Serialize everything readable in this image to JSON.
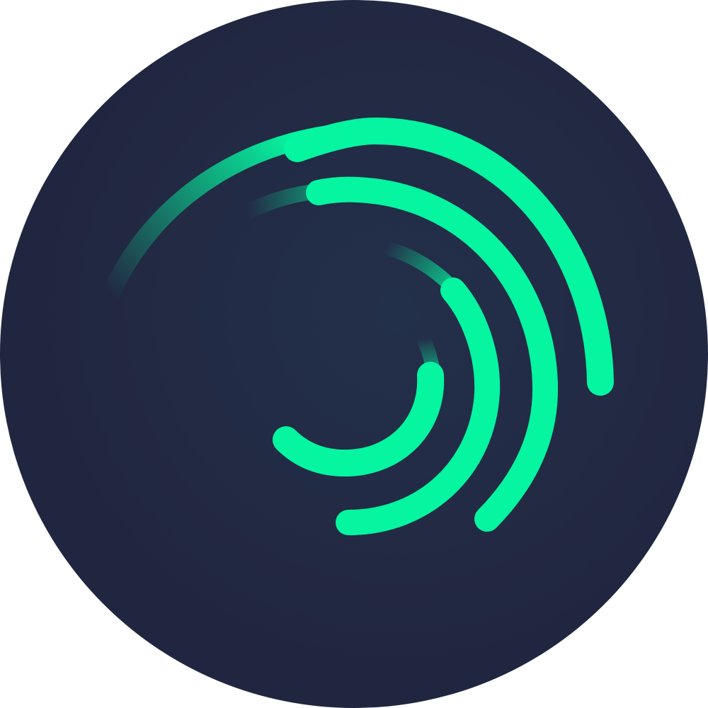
{
  "logo": {
    "icon": "spiral-arcs-logo-icon",
    "colors": {
      "background": "#212640",
      "background_center": "#23304a",
      "accent": "#05f5a0"
    }
  }
}
